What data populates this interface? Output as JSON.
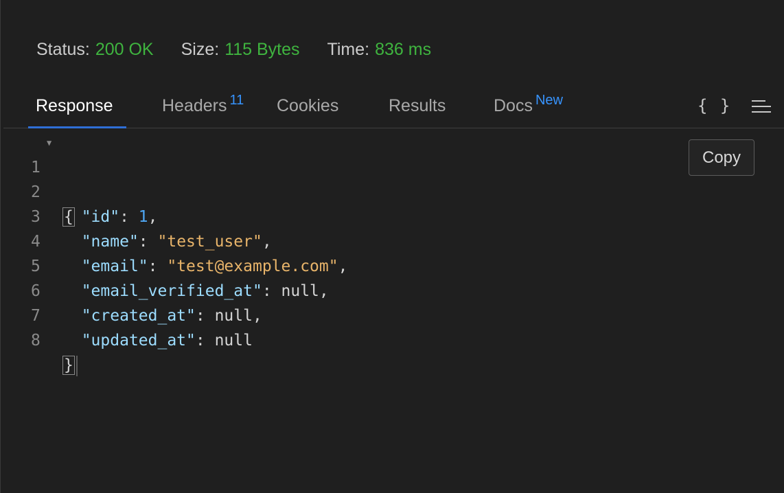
{
  "status_bar": {
    "status_label": "Status:",
    "status_value": "200 OK",
    "size_label": "Size:",
    "size_value": "115 Bytes",
    "time_label": "Time:",
    "time_value": "836 ms",
    "value_color": "#3fb43f"
  },
  "tabs": [
    {
      "label": "Response",
      "active": true
    },
    {
      "label": "Headers",
      "badge": "11"
    },
    {
      "label": "Cookies"
    },
    {
      "label": "Results"
    },
    {
      "label": "Docs",
      "badge": "New"
    }
  ],
  "toolbar": {
    "format_icon": "braces-icon",
    "format_glyph": "{ }",
    "menu_icon": "menu-icon",
    "copy_label": "Copy"
  },
  "editor": {
    "line_numbers": [
      "1",
      "2",
      "3",
      "4",
      "5",
      "6",
      "7",
      "8"
    ],
    "open_brace": "{",
    "close_brace": "}",
    "entries": [
      {
        "key": "\"id\"",
        "value": "1",
        "type": "number",
        "trail": ","
      },
      {
        "key": "\"name\"",
        "value": "\"test_user\"",
        "type": "string",
        "trail": ","
      },
      {
        "key": "\"email\"",
        "value": "\"test@example.com\"",
        "type": "string",
        "trail": ","
      },
      {
        "key": "\"email_verified_at\"",
        "value": "null",
        "type": "null",
        "trail": ","
      },
      {
        "key": "\"created_at\"",
        "value": "null",
        "type": "null",
        "trail": ","
      },
      {
        "key": "\"updated_at\"",
        "value": "null",
        "type": "null",
        "trail": ""
      }
    ]
  }
}
